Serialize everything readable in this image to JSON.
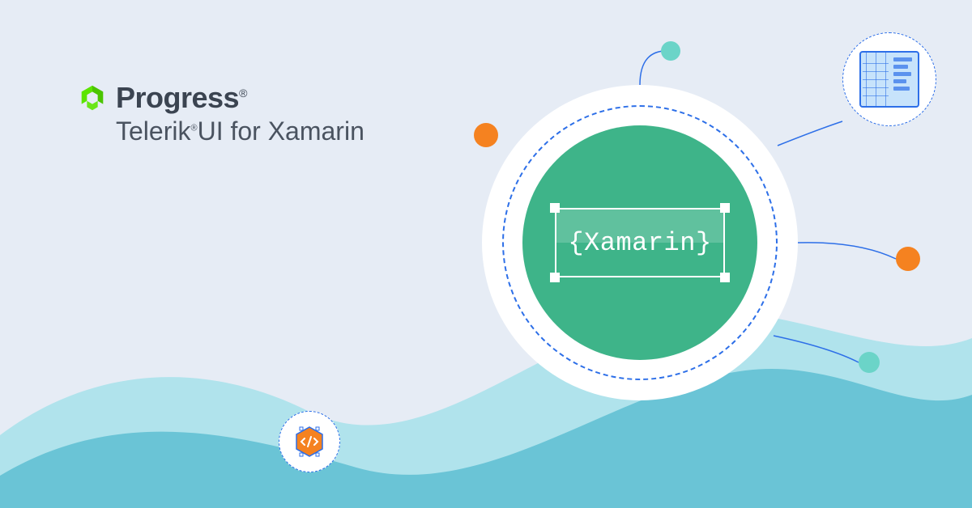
{
  "brand": {
    "name": "Progress",
    "registered": "®",
    "product_prefix": "Telerik",
    "product_registered": "®",
    "product_suffix": "UI for Xamarin"
  },
  "hero": {
    "label": "{Xamarin}"
  },
  "colors": {
    "background": "#e6ecf5",
    "brand_green": "#5ce500",
    "text_dark": "#3b4451",
    "accent_blue": "#2d6fe8",
    "circle_green": "#3eb489",
    "orange": "#f58220",
    "teal": "#6bd4c8",
    "wave_light": "#b0e3ec",
    "wave_dark": "#6ac4d6"
  },
  "icons": {
    "logo": "progress-chevrons-icon",
    "code_sat": "code-hexagon-icon",
    "grid_sat": "data-grid-icon"
  }
}
